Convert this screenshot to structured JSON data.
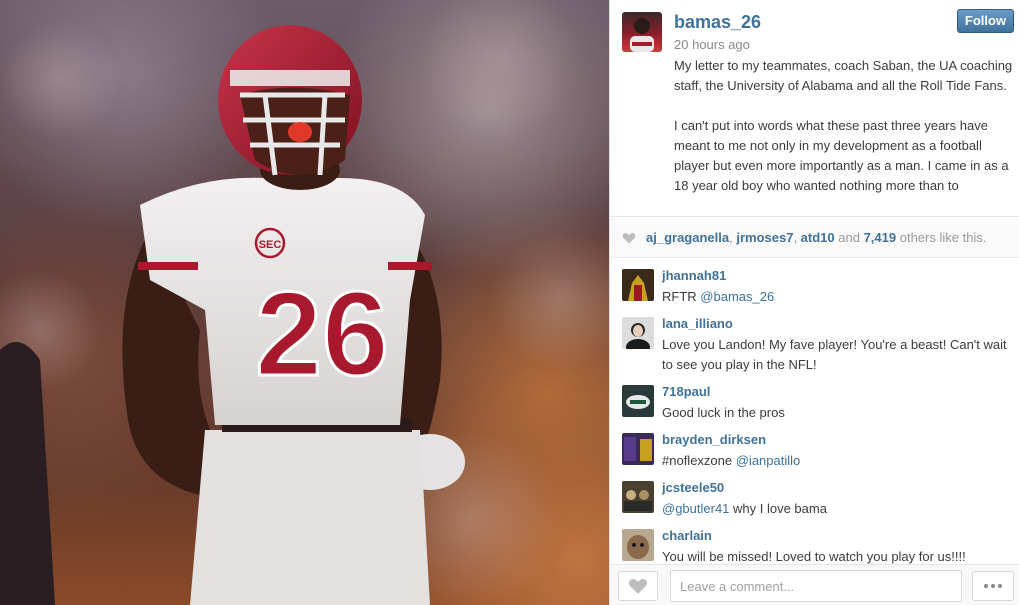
{
  "photo": {
    "jersey_number": "26",
    "icon": "football-player-photo"
  },
  "post": {
    "username": "bamas_26",
    "time": "20 hours ago",
    "follow_label": "Follow",
    "caption": "My letter to my teammates, coach Saban, the UA coaching staff, the University of Alabama and all the Roll Tide Fans.\n\nI can't put into words what these past three years have meant to me not only in my development as a football player but even more importantly as a man. I came in as a 18 year old boy who wanted nothing more than to"
  },
  "likes": {
    "user1": "aj_graganella",
    "sep1": ", ",
    "user2": "jrmoses7",
    "sep2": ", ",
    "user3": "atd10",
    "and": " and ",
    "count": "7,419",
    "suffix": " others like this."
  },
  "comments": [
    {
      "user": "jhannah81",
      "text": "RFTR ",
      "mention": "@bamas_26",
      "tail": ""
    },
    {
      "user": "lana_illiano",
      "text": "Love you Landon! My fave player! You're a beast! Can't wait to see you play in the NFL!",
      "mention": "",
      "tail": ""
    },
    {
      "user": "718paul",
      "text": "Good luck in the pros",
      "mention": "",
      "tail": ""
    },
    {
      "user": "brayden_dirksen",
      "text": "#noflexzone ",
      "mention": "@ianpatillo",
      "tail": ""
    },
    {
      "user": "jcsteele50",
      "text": "",
      "mention": "@gbutler41",
      "tail": " why I love bama"
    },
    {
      "user": "charlain",
      "text": "You will be missed! Loved to watch you play for us!!!!",
      "mention": "",
      "tail": ""
    }
  ],
  "footer": {
    "comment_placeholder": "Leave a comment..."
  },
  "colors": {
    "link": "#3f729b",
    "crimson": "#a8192e"
  }
}
